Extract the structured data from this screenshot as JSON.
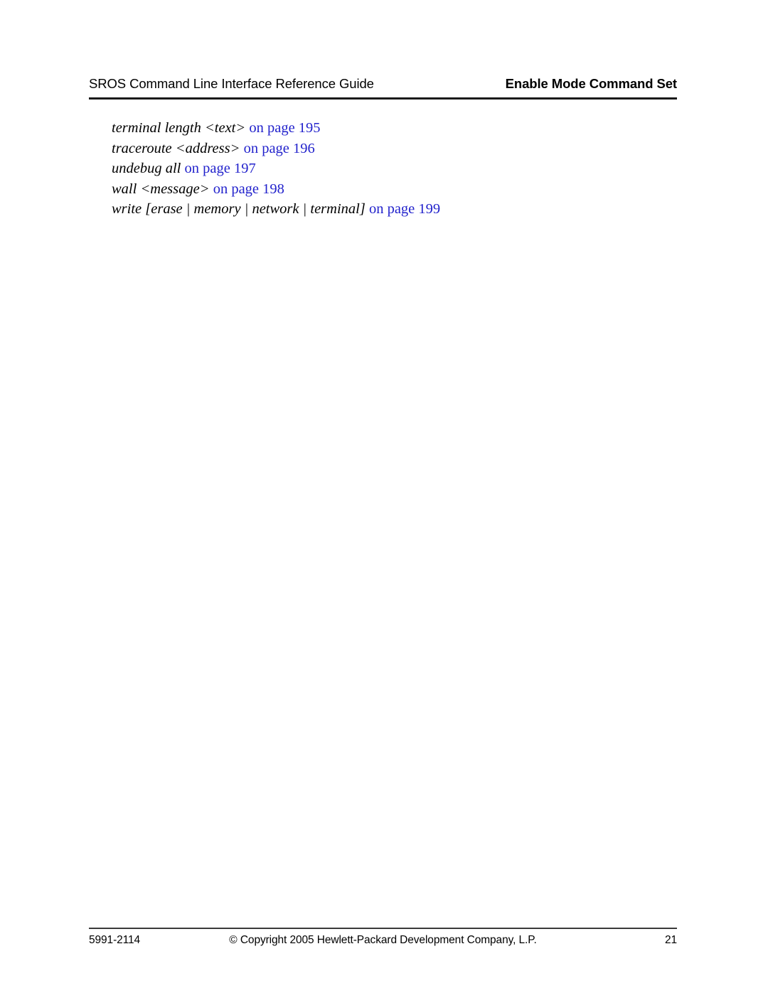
{
  "header": {
    "left_title": "SROS Command Line Interface Reference Guide",
    "right_title": "Enable Mode Command Set"
  },
  "xref_entries": [
    {
      "command": "terminal length <text>",
      "link": "on page",
      "page": "195"
    },
    {
      "command": "traceroute <address>",
      "link": "on page",
      "page": "196"
    },
    {
      "command": "undebug all",
      "link": "on page",
      "page": "197"
    },
    {
      "command": "wall <message>",
      "link": "on page",
      "page": "198"
    },
    {
      "command": "write [erase | memory | network | terminal]",
      "link": "on page",
      "page": "199"
    }
  ],
  "footer": {
    "document_number": "5991-2114",
    "copyright": "© Copyright 2005 Hewlett-Packard Development Company, L.P.",
    "page_number": "21"
  },
  "colors": {
    "link_blue": "#2222cc",
    "text_black": "#000000",
    "rule_dark": "#1a1a1a"
  }
}
